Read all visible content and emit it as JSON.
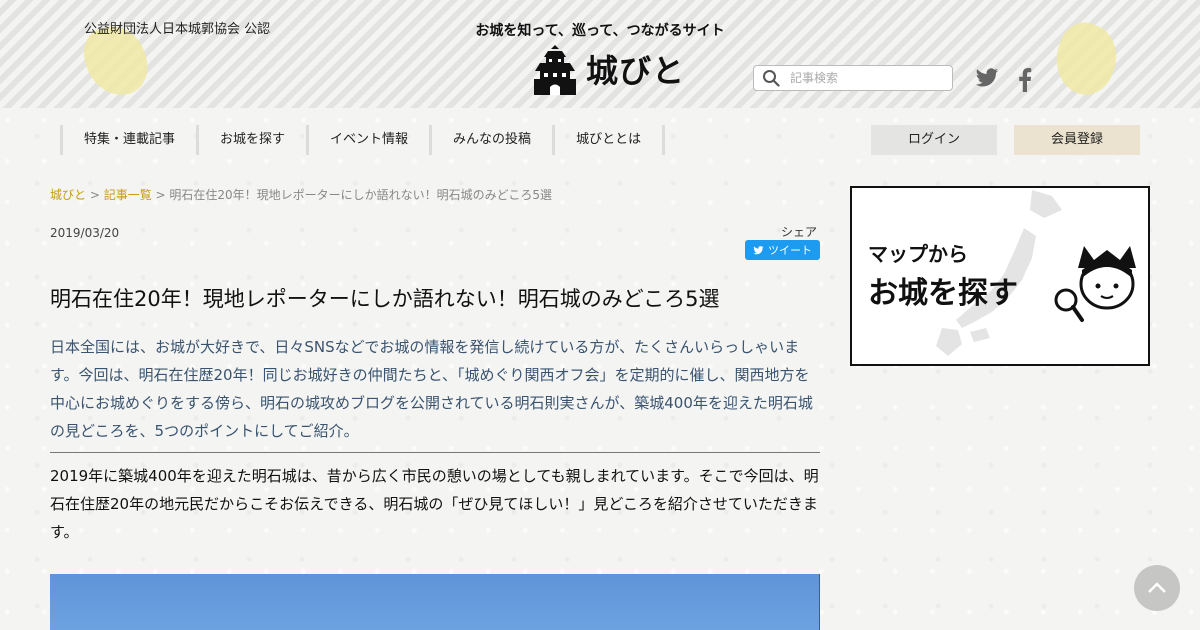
{
  "header": {
    "org": "公益財団法人日本城郭協会 公認",
    "tagline": "お城を知って、巡って、つながるサイト",
    "logo_text": "城びと",
    "search_placeholder": "記事検索",
    "social": [
      "twitter-icon",
      "facebook-icon"
    ]
  },
  "nav": {
    "items": [
      "特集・連載記事",
      "お城を探す",
      "イベント情報",
      "みんなの投稿",
      "城びととは"
    ],
    "login": "ログイン",
    "register": "会員登録"
  },
  "breadcrumb": {
    "home": "城びと",
    "sep1": " > ",
    "list": "記事一覧",
    "sep2": " > ",
    "current": "明石在住20年！現地レポーターにしか語れない！明石城のみどころ5選"
  },
  "article": {
    "date": "2019/03/20",
    "share_label": "シェア",
    "tweet_label": "ツイート",
    "title": "明石在住20年！現地レポーターにしか語れない！明石城のみどころ5選",
    "lead": "日本全国には、お城が大好きで、日々SNSなどでお城の情報を発信し続けている方が、たくさんいらっしゃいます。今回は、明石在住歴20年！同じお城好きの仲間たちと、「城めぐり関西オフ会」を定期的に催し、関西地方を中心にお城めぐりをする傍ら、明石の城攻めブログを公開されている明石則実さんが、築城400年を迎えた明石城の見どころを、5つのポイントにしてご紹介。",
    "body": "2019年に築城400年を迎えた明石城は、昔から広く市民の憩いの場としても親しまれています。そこで今回は、明石在住歴20年の地元民だからこそお伝えできる、明石城の「ぜひ見てほしい！」見どころを紹介させていただきます。"
  },
  "sidebar": {
    "banner_line1": "マップから",
    "banner_line2": "お城を探す"
  },
  "colors": {
    "accent_link": "#c79a12",
    "lead_text": "#3a5470",
    "tweet": "#1d9bf0"
  }
}
